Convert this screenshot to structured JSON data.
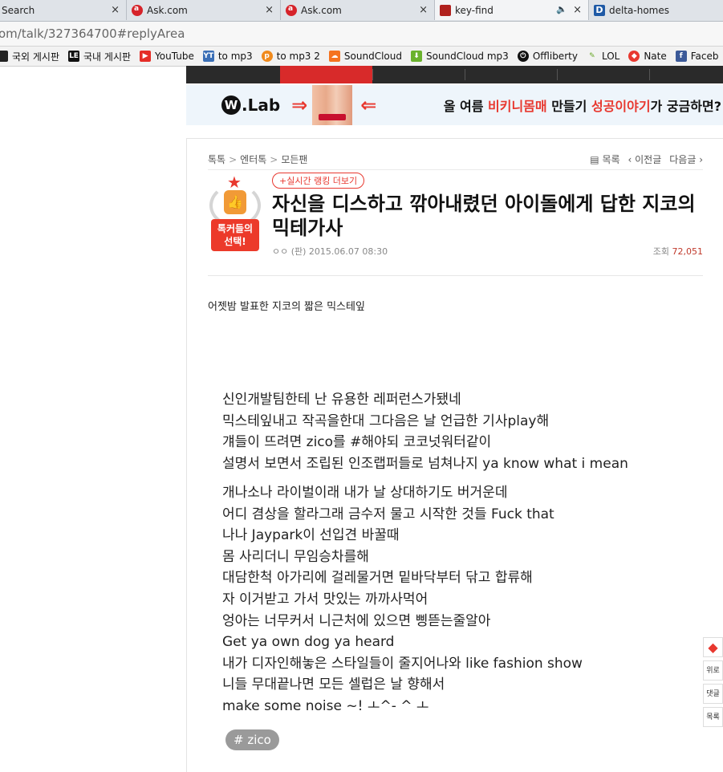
{
  "tabs": [
    {
      "title": "Search",
      "favicon": "none"
    },
    {
      "title": "Ask.com",
      "favicon": "ask-icon"
    },
    {
      "title": "Ask.com",
      "favicon": "ask-icon"
    },
    {
      "title": "key-find",
      "favicon": "key-find-icon"
    },
    {
      "title": "delta-homes",
      "favicon": "delta-icon"
    }
  ],
  "tab_close_glyph": "×",
  "audio_glyph": "🔈",
  "address": {
    "url": "om/talk/327364700#replyArea"
  },
  "bookmarks": [
    {
      "label": "국외 게시판",
      "icon": "board-icon"
    },
    {
      "label": "국내 게시판",
      "icon": "le-icon"
    },
    {
      "label": "YouTube",
      "icon": "youtube-icon"
    },
    {
      "label": "to mp3",
      "icon": "mp3-icon"
    },
    {
      "label": "to mp3 2",
      "icon": "mp3-2-icon"
    },
    {
      "label": "SoundCloud",
      "icon": "soundcloud-icon"
    },
    {
      "label": "SoundCloud mp3",
      "icon": "download-icon"
    },
    {
      "label": "Offliberty",
      "icon": "power-icon"
    },
    {
      "label": "LOL",
      "icon": "pen-icon"
    },
    {
      "label": "Nate",
      "icon": "nate-icon"
    },
    {
      "label": "Faceb",
      "icon": "facebook-icon"
    }
  ],
  "banner": {
    "logo_text": "Lab",
    "logo_circle": "W",
    "headline_pre": "올 여름 ",
    "headline_hl1": "비키니몸매",
    "headline_mid": " 만들기 ",
    "headline_hl2": "성공이야기",
    "headline_post": "가 궁금하면?"
  },
  "breadcrumb": {
    "items": [
      "톡톡",
      "엔터톡",
      "모든팬"
    ],
    "sep": ">"
  },
  "article_nav": {
    "list": "▤ 목록",
    "prev": "‹ 이전글",
    "next": "다음글 ›"
  },
  "badge": {
    "ribbon_line1": "톡커들의",
    "ribbon_line2": "선택!"
  },
  "realtime_button": "+실시간 랭킹 더보기",
  "title": "자신을 디스하고 깎아내렸던 아이돌에게 답한 지코의 믹테가사",
  "meta": "ㅇㅇ (판) 2015.06.07 08:30",
  "views": {
    "label": "조회 ",
    "count": "72,051"
  },
  "intro": "어젯밤 발표한 지코의 짧은 믹스테잎",
  "lyrics_stanza1": [
    "신인개발팀한테 난 유용한 레퍼런스가됐네",
    "믹스테잎내고 작곡을한대 그다음은 날 언급한 기사play해",
    "걔들이 뜨려면 zico를 #해야되 코코넛워터같이",
    "설명서 보면서 조립된 인조랩퍼들로 넘쳐나지 ya know what i mean"
  ],
  "lyrics_stanza2": [
    "개나소나 라이벌이래 내가 날 상대하기도 버거운데",
    "어디 겸상을 할라그래 금수저 물고 시작한 것들 Fuck that",
    "나나 Jaypark이 선입견 바꿀때",
    "몸 사리더니 무임승차를해",
    "대담한척 아가리에 걸레물거면 밑바닥부터 닦고 합류해",
    "자 이거받고 가서 맛있는 까까사먹어",
    "엉아는 너무커서 니근처에 있으면 삥뜯는줄알아",
    "Get ya own dog ya heard",
    "내가 디자인해놓은 스타일들이 줄지어나와 like fashion show",
    "니들 무대끝나면 모든 셀럽은 날 향해서",
    "make some noise ~! ㅗ^- ^ ㅗ"
  ],
  "tag": "# zico",
  "float_buttons": [
    "위로",
    "댓글",
    "목록"
  ]
}
